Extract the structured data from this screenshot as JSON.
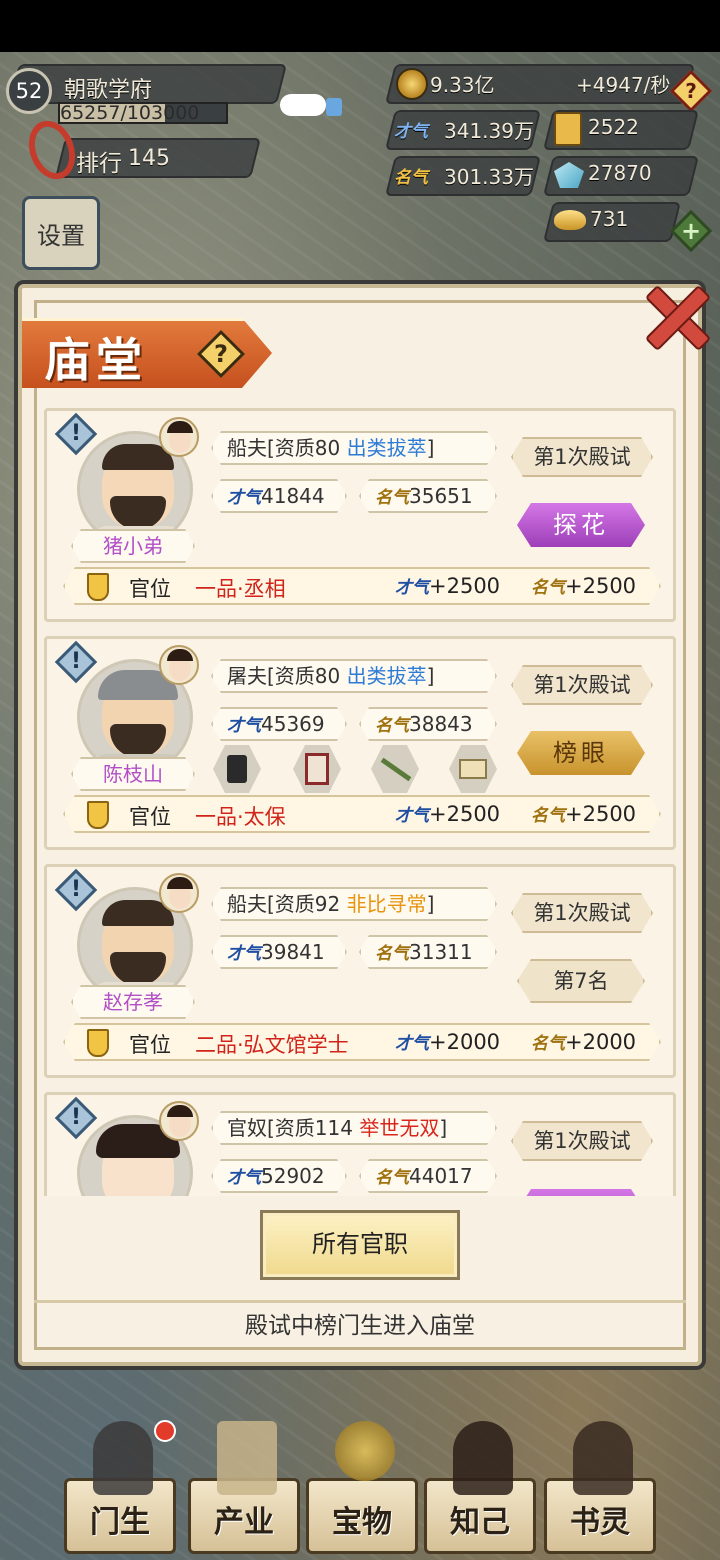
{
  "hud": {
    "level": "52",
    "school_name": "朝歌学府",
    "progress_text": "65257/103000",
    "progress_fraction": 0.634,
    "rank_label": "排行",
    "rank_value": "145",
    "settings_label": "设置",
    "money": "9.33亿",
    "money_rate": "+4947/秒",
    "talent": "341.39万",
    "ticket": "2522",
    "fame": "301.33万",
    "gem": "27870",
    "ingot": "731",
    "talent_tag": "才气",
    "fame_tag": "名气"
  },
  "panel": {
    "title": "庙堂",
    "help_icon": "?",
    "all_positions_button": "所有官职",
    "footer_note": "殿试中榜门生进入庙堂"
  },
  "cards": [
    {
      "name": "猪小弟",
      "profession": "船夫[资质80",
      "grade": "出类拔萃",
      "grade_color": "#2e7bd6",
      "close_bracket": "]",
      "talent_tag": "才气",
      "talent": "41844",
      "fame_tag": "名气",
      "fame": "35651",
      "exam": "第1次殿试",
      "rank": "探花",
      "office_label": "官位",
      "office": "一品·丞相",
      "talent_bonus_tag": "才气",
      "talent_bonus": "+2500",
      "fame_bonus_tag": "名气",
      "fame_bonus": "+2500"
    },
    {
      "name": "陈枝山",
      "profession": "屠夫[资质80",
      "grade": "出类拔萃",
      "grade_color": "#2e7bd6",
      "close_bracket": "]",
      "talent_tag": "才气",
      "talent": "45369",
      "fame_tag": "名气",
      "fame": "38843",
      "exam": "第1次殿试",
      "rank": "榜眼",
      "office_label": "官位",
      "office": "一品·太保",
      "talent_bonus_tag": "才气",
      "talent_bonus": "+2500",
      "fame_bonus_tag": "名气",
      "fame_bonus": "+2500",
      "items": [
        "inkstone-icon",
        "scroll-frame-icon",
        "brush-icon",
        "box-icon"
      ]
    },
    {
      "name": "赵存孝",
      "profession": "船夫[资质92",
      "grade": "非比寻常",
      "grade_color": "#e8940f",
      "close_bracket": "]",
      "talent_tag": "才气",
      "talent": "39841",
      "fame_tag": "名气",
      "fame": "31311",
      "exam": "第1次殿试",
      "rank": "第7名",
      "office_label": "官位",
      "office": "二品·弘文馆学士",
      "talent_bonus_tag": "才气",
      "talent_bonus": "+2000",
      "fame_bonus_tag": "名气",
      "fame_bonus": "+2000"
    },
    {
      "profession": "官奴[资质114",
      "grade": "举世无双",
      "grade_color": "#d9261c",
      "close_bracket": "]",
      "talent_tag": "才气",
      "talent": "52902",
      "fame_tag": "名气",
      "fame": "44017",
      "exam": "第1次殿试"
    }
  ],
  "nav": {
    "disciples": "门生",
    "property": "产业",
    "treasure": "宝物",
    "confidant": "知己",
    "book_spirit": "书灵"
  }
}
